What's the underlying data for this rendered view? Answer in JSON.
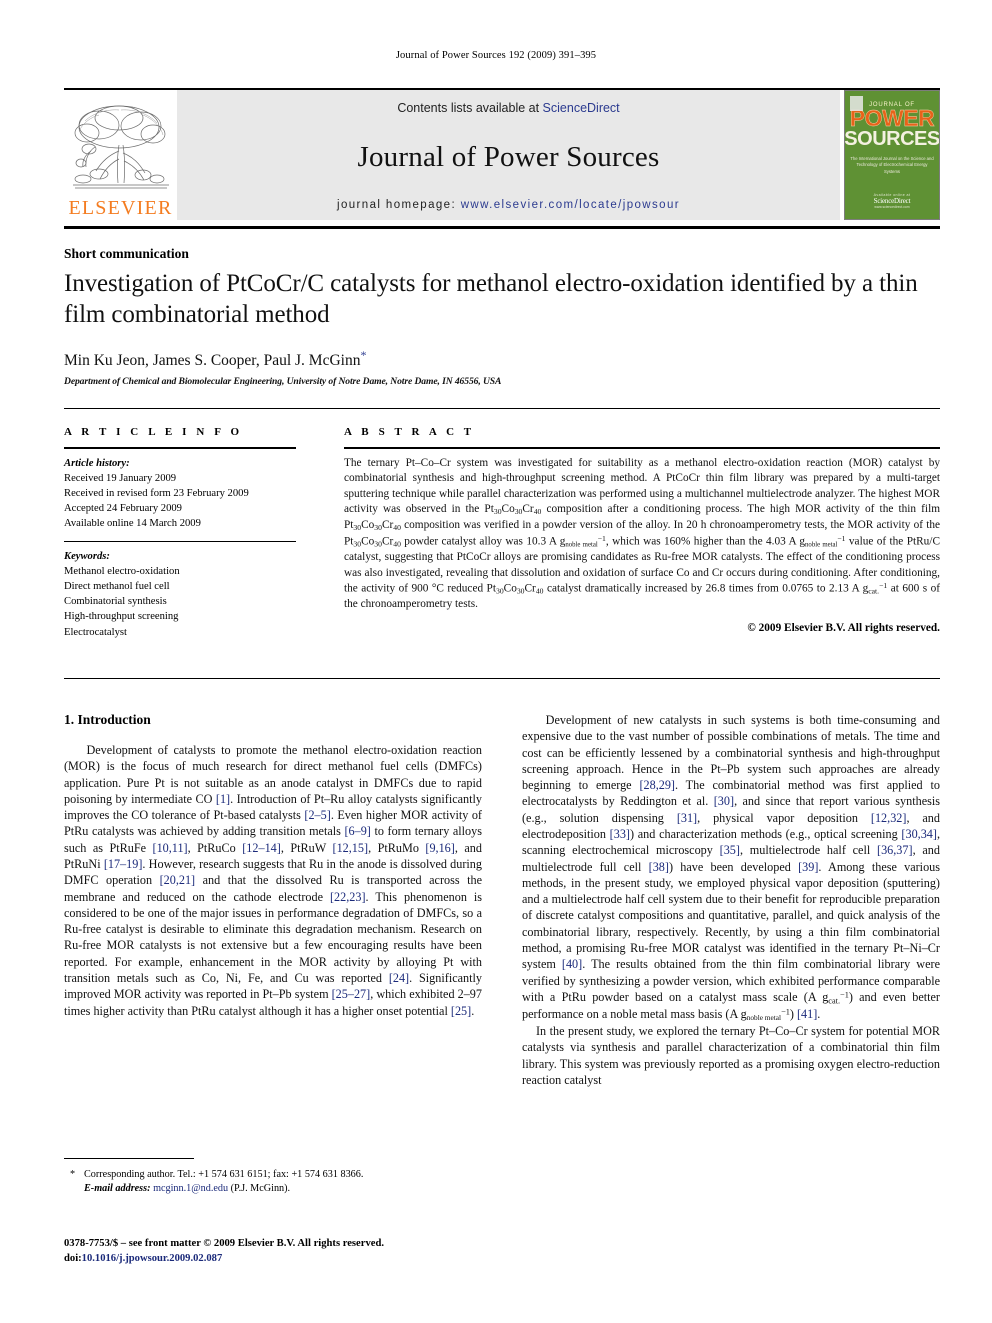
{
  "running_head": "Journal of Power Sources 192 (2009) 391–395",
  "masthead": {
    "elsevier_wordmark": "ELSEVIER",
    "contents_prefix": "Contents lists available at ",
    "contents_link": "ScienceDirect",
    "journal_title": "Journal of Power Sources",
    "homepage_prefix": "journal homepage: ",
    "homepage_url": "www.elsevier.com/locate/jpowsour",
    "cover": {
      "kicker": "JOURNAL OF",
      "title_line1": "POWER",
      "title_line2": "SOURCES",
      "subtitle": "The International Journal on the Science and Technology of Electrochemical Energy Systems",
      "badge_top": "Available online at",
      "badge_mid": "ScienceDirect",
      "badge_bottom": "www.sciencedirect.com"
    }
  },
  "article": {
    "doctype": "Short communication",
    "title": "Investigation of PtCoCr/C catalysts for methanol electro-oxidation identified by a thin film combinatorial method",
    "authors": "Min Ku Jeon, James S. Cooper, Paul J. McGinn",
    "corresponding_marker": "*",
    "affiliation": "Department of Chemical and Biomolecular Engineering, University of Notre Dame, Notre Dame, IN 46556, USA"
  },
  "article_info": {
    "heading": "ARTICLE INFO",
    "history_label": "Article history:",
    "history": [
      "Received 19 January 2009",
      "Received in revised form 23 February 2009",
      "Accepted 24 February 2009",
      "Available online 14 March 2009"
    ],
    "keywords_label": "Keywords:",
    "keywords": [
      "Methanol electro-oxidation",
      "Direct methanol fuel cell",
      "Combinatorial synthesis",
      "High-throughput screening",
      "Electrocatalyst"
    ]
  },
  "abstract": {
    "heading": "ABSTRACT",
    "copyright": "© 2009 Elsevier B.V. All rights reserved."
  },
  "introduction": {
    "heading": "1. Introduction"
  },
  "footnote": {
    "star": "*",
    "line1": "Corresponding author. Tel.: +1 574 631 6151; fax: +1 574 631 8366.",
    "email_label": "E-mail address:",
    "email": "mcginn.1@nd.edu",
    "email_owner": "(P.J. McGinn)."
  },
  "imprint": {
    "line1": "0378-7753/$ – see front matter © 2009 Elsevier B.V. All rights reserved.",
    "doi_label": "doi:",
    "doi_value": "10.1016/j.jpowsour.2009.02.087"
  },
  "colors": {
    "elsevier_orange": "#F47C20",
    "link_blue": "#1b2a7a",
    "banner_grey": "#e8e8e8",
    "cover_green": "#5f9134",
    "cover_orange": "#e8631a"
  }
}
